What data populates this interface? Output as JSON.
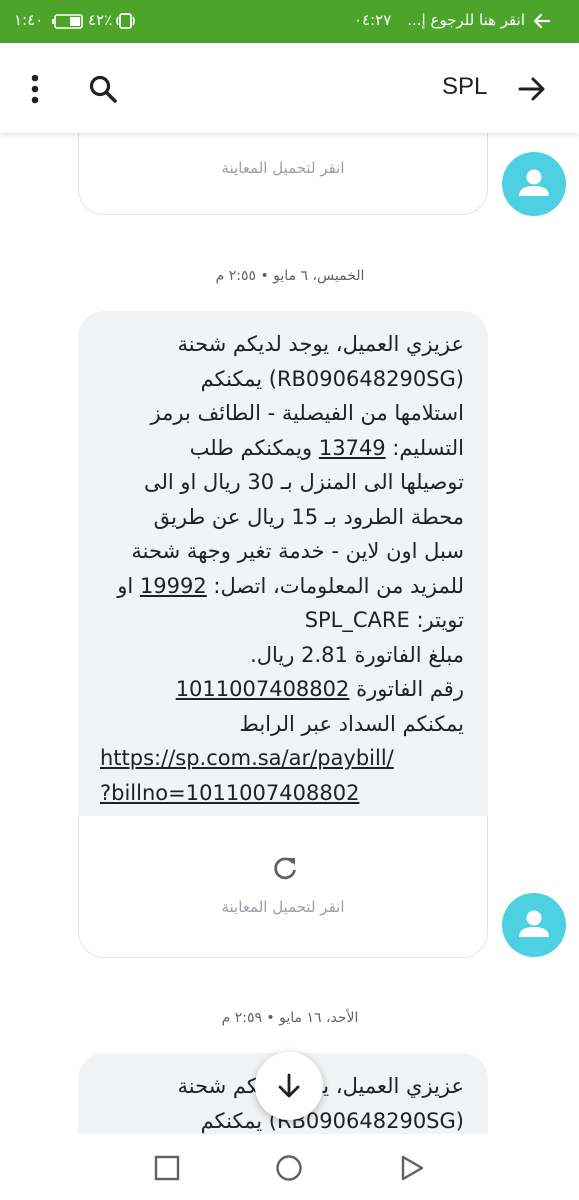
{
  "status_bar": {
    "back_hint": "انقر هنا للرجوع إ...",
    "time_left": "١:٤٠",
    "battery": "٤٢٪",
    "time_right": "٠٤:٢٧"
  },
  "header": {
    "title": "SPL",
    "back_icon": "arrow-right-icon",
    "search_icon": "search-icon",
    "menu_icon": "more-vertical-icon"
  },
  "messages": [
    {
      "preview_label": "انقر لتحميل المعاينة"
    },
    {
      "timestamp": "الخميس، ٦ مايو • ٢:٥٥ م",
      "line1": "عزيزي العميل، يوجد لديكم شحنة",
      "line2": "(RB090648290SG) يمكنكم",
      "line3": "استلامها من الفيصلية - الطائف برمز",
      "line4_prefix": "التسليم: ",
      "line4_code": "13749",
      "line4_suffix": " ويمكنكم طلب",
      "line5": "توصيلها الى المنزل بـ 30 ريال او الى",
      "line6": "محطة الطرود بـ 15 ريال عن طريق",
      "line7": "سبل اون لاين - خدمة تغير وجهة شحنة",
      "line8_prefix": "للمزيد من المعلومات، اتصل: ",
      "line8_phone": "19992",
      "line8_suffix": " او",
      "line9": "تويتر: SPL_CARE",
      "line10": "مبلغ الفاتورة 2.81 ريال.",
      "line11_prefix": "رقم الفاتورة ",
      "line11_invoice": "1011007408802",
      "line12": "يمكنكم السداد عبر الرابط",
      "link_line1": "https://sp.com.sa/ar/paybill/",
      "link_line2": "?billno=1011007408802",
      "preview_label": "انقر لتحميل المعاينة"
    },
    {
      "timestamp": "الأحد، ١٦ مايو • ٢:٥٩ م",
      "line1": "عزيزي العميل، يوجد لديكم شحنة",
      "line2": "(RB090648290SG) يمكنكم"
    }
  ],
  "scroll_button_icon": "arrow-down-icon",
  "nav": {
    "recents_icon": "square-icon",
    "home_icon": "circle-icon",
    "back_icon": "triangle-back-icon"
  }
}
